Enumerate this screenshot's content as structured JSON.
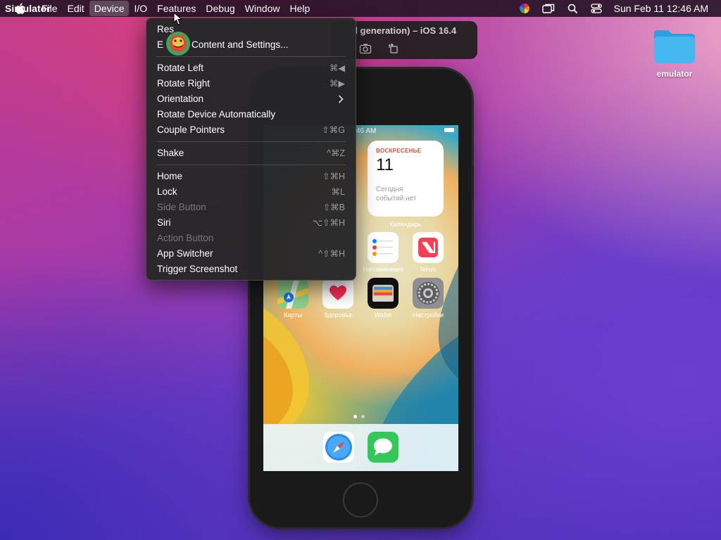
{
  "menubar": {
    "app_name": "Simulator",
    "items": [
      "File",
      "Edit",
      "Device",
      "I/O",
      "Features",
      "Debug",
      "Window",
      "Help"
    ],
    "active_item": "Device",
    "clock": "Sun Feb 11  12:46 AM",
    "status_icons": [
      "color-wheel-icon",
      "window-switch-icon",
      "search-icon",
      "control-center-icon"
    ]
  },
  "sim_window": {
    "title": "d generation) – iOS 16.4",
    "buttons": [
      "screenshot-icon",
      "rotate-icon"
    ]
  },
  "device_menu": {
    "items": [
      {
        "label": "Res",
        "shortcut": "",
        "enabled": true
      },
      {
        "label": "E",
        "label_tail": "Content and Settings...",
        "shortcut": "",
        "enabled": true
      },
      {
        "sep": true
      },
      {
        "label": "Rotate Left",
        "shortcut": "⌘◀",
        "enabled": true
      },
      {
        "label": "Rotate Right",
        "shortcut": "⌘▶",
        "enabled": true
      },
      {
        "label": "Orientation",
        "shortcut": "",
        "enabled": true,
        "submenu": true
      },
      {
        "label": "Rotate Device Automatically",
        "shortcut": "",
        "enabled": true
      },
      {
        "label": "Couple Pointers",
        "shortcut": "⇧⌘G",
        "enabled": true
      },
      {
        "sep": true
      },
      {
        "label": "Shake",
        "shortcut": "^⌘Z",
        "enabled": true
      },
      {
        "sep": true
      },
      {
        "label": "Home",
        "shortcut": "⇧⌘H",
        "enabled": true
      },
      {
        "label": "Lock",
        "shortcut": "⌘L",
        "enabled": true
      },
      {
        "label": "Side Button",
        "shortcut": "⇧⌘B",
        "enabled": false
      },
      {
        "label": "Siri",
        "shortcut": "⌥⇧⌘H",
        "enabled": true
      },
      {
        "label": "Action Button",
        "shortcut": "",
        "enabled": false
      },
      {
        "label": "App Switcher",
        "shortcut": "^⇧⌘H",
        "enabled": true
      },
      {
        "label": "Trigger Screenshot",
        "shortcut": "",
        "enabled": true
      }
    ]
  },
  "phone": {
    "status_time": "46 AM",
    "widget": {
      "weekday": "ВОСКРЕСЕНЬЕ",
      "date": "11",
      "text_line1": "Сегодня",
      "text_line2": "событий нет",
      "label": "Календарь"
    },
    "apps_row1": [
      {
        "name": "reminders",
        "label": "Напоминания"
      },
      {
        "name": "news",
        "label": "News"
      }
    ],
    "apps_row2": [
      {
        "name": "maps",
        "label": "Карты"
      },
      {
        "name": "health",
        "label": "Здоровье"
      },
      {
        "name": "wallet",
        "label": "Wallet"
      },
      {
        "name": "settings",
        "label": "Настройки"
      }
    ],
    "dock": [
      "safari-icon",
      "messages-icon"
    ],
    "page_dots": 2,
    "active_page": 0
  },
  "desktop": {
    "folder_label": "emulator"
  },
  "colors": {
    "menu_bg": "#262628",
    "accent_red": "#e0473b",
    "messages_green": "#34c759",
    "folder_blue": "#3fb5f0"
  }
}
